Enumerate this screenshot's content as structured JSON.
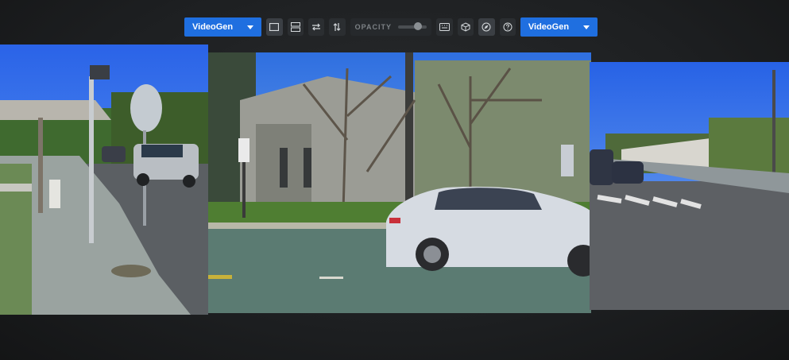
{
  "toolbar": {
    "left_dropdown": {
      "label": "VideoGen"
    },
    "right_dropdown": {
      "label": "VideoGen"
    },
    "opacity_label": "OPACITY",
    "opacity_level": 0.7
  },
  "colors": {
    "accent": "#1f6fe0",
    "toolbar_bg": "#2b2e31",
    "background": "#1b1d1f"
  },
  "icons": [
    "single-view-icon",
    "stack-view-icon",
    "swap-icon",
    "flip-vertical-icon",
    "keyboard-icon",
    "cube-icon",
    "compass-icon",
    "help-icon"
  ]
}
